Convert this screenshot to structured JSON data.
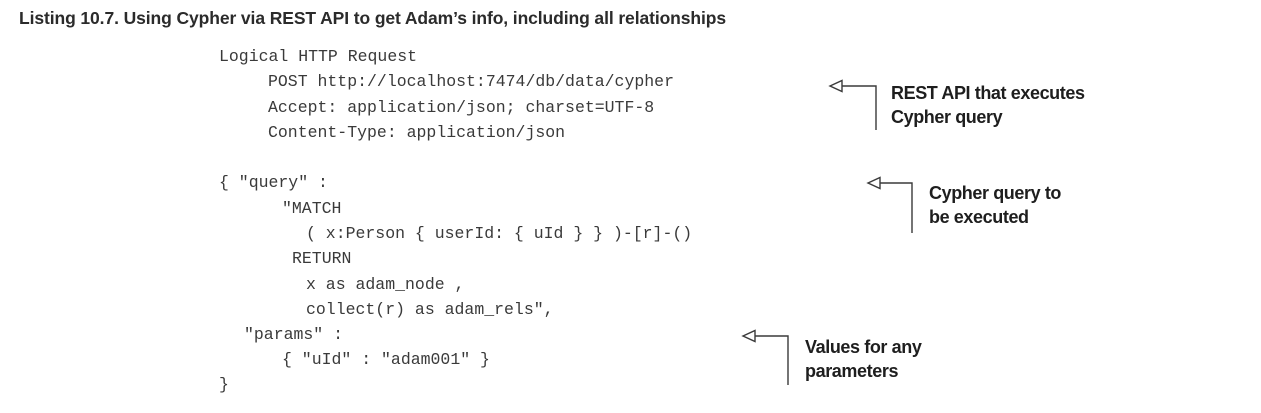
{
  "caption": "Listing 10.7. Using Cypher via REST API to get Adam’s info, including all relationships",
  "code_lines": [
    "Logical HTTP Request",
    "POST http://localhost:7474/db/data/cypher",
    "Accept: application/json; charset=UTF-8",
    "Content-Type: application/json",
    "{ \"query\" :",
    "\"MATCH",
    "( x:Person { userId: { uId } } )-[r]-()",
    "RETURN",
    "x as adam_node ,",
    "collect(r) as adam_rels\",",
    "\"params\" :",
    "{ \"uId\" : \"adam001\" }",
    "}"
  ],
  "annotations": [
    {
      "lines": [
        "REST API that executes",
        "Cypher query"
      ]
    },
    {
      "lines": [
        "Cypher query to",
        "be executed"
      ]
    },
    {
      "lines": [
        "Values for any",
        "parameters"
      ]
    }
  ]
}
